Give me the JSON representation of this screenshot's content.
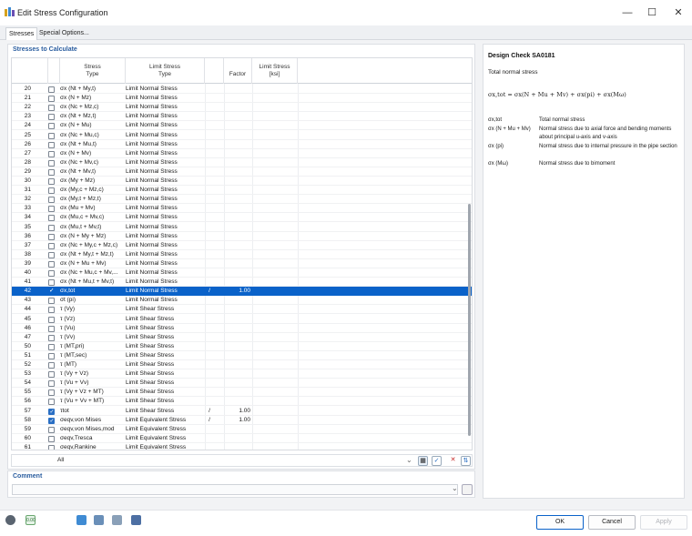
{
  "window": {
    "title": "Edit Stress Configuration",
    "min_glyph": "—",
    "max_glyph": "☐",
    "close_glyph": "✕"
  },
  "tabs": [
    {
      "label": "Stresses"
    },
    {
      "label": "Special Options..."
    }
  ],
  "stresses_panel": {
    "title": "Stresses to Calculate",
    "columns": {
      "stress_type": "Stress\nType",
      "limit_type": "Limit Stress\nType",
      "factor": "Factor",
      "limit_stress": "Limit Stress\n[ksi]"
    },
    "filter_value": "All",
    "rows": [
      {
        "num": "20",
        "checked": false,
        "type": "σx (Nt + My,t)",
        "limit": "Limit Normal Stress",
        "slash": "",
        "factor": ""
      },
      {
        "num": "21",
        "checked": false,
        "type": "σx (N + Mz)",
        "limit": "Limit Normal Stress",
        "slash": "",
        "factor": ""
      },
      {
        "num": "22",
        "checked": false,
        "type": "σx (Nc + Mz,c)",
        "limit": "Limit Normal Stress",
        "slash": "",
        "factor": ""
      },
      {
        "num": "23",
        "checked": false,
        "type": "σx (Nt + Mz,t)",
        "limit": "Limit Normal Stress",
        "slash": "",
        "factor": ""
      },
      {
        "num": "24",
        "checked": false,
        "type": "σx (N + Mu)",
        "limit": "Limit Normal Stress",
        "slash": "",
        "factor": ""
      },
      {
        "num": "25",
        "checked": false,
        "type": "σx (Nc + Mu,c)",
        "limit": "Limit Normal Stress",
        "slash": "",
        "factor": ""
      },
      {
        "num": "26",
        "checked": false,
        "type": "σx (Nt + Mu,t)",
        "limit": "Limit Normal Stress",
        "slash": "",
        "factor": ""
      },
      {
        "num": "27",
        "checked": false,
        "type": "σx (N + Mv)",
        "limit": "Limit Normal Stress",
        "slash": "",
        "factor": ""
      },
      {
        "num": "28",
        "checked": false,
        "type": "σx (Nc + Mv,c)",
        "limit": "Limit Normal Stress",
        "slash": "",
        "factor": ""
      },
      {
        "num": "29",
        "checked": false,
        "type": "σx (Nt + Mv,t)",
        "limit": "Limit Normal Stress",
        "slash": "",
        "factor": ""
      },
      {
        "num": "30",
        "checked": false,
        "type": "σx (My + Mz)",
        "limit": "Limit Normal Stress",
        "slash": "",
        "factor": ""
      },
      {
        "num": "31",
        "checked": false,
        "type": "σx (My,c + Mz,c)",
        "limit": "Limit Normal Stress",
        "slash": "",
        "factor": ""
      },
      {
        "num": "32",
        "checked": false,
        "type": "σx (My,t + Mz,t)",
        "limit": "Limit Normal Stress",
        "slash": "",
        "factor": ""
      },
      {
        "num": "33",
        "checked": false,
        "type": "σx (Mu + Mv)",
        "limit": "Limit Normal Stress",
        "slash": "",
        "factor": ""
      },
      {
        "num": "34",
        "checked": false,
        "type": "σx (Mu,c + Mv,c)",
        "limit": "Limit Normal Stress",
        "slash": "",
        "factor": ""
      },
      {
        "num": "35",
        "checked": false,
        "type": "σx (Mu,t + Mv,t)",
        "limit": "Limit Normal Stress",
        "slash": "",
        "factor": ""
      },
      {
        "num": "36",
        "checked": false,
        "type": "σx (N + My + Mz)",
        "limit": "Limit Normal Stress",
        "slash": "",
        "factor": ""
      },
      {
        "num": "37",
        "checked": false,
        "type": "σx (Nc + My,c + Mz,c)",
        "limit": "Limit Normal Stress",
        "slash": "",
        "factor": ""
      },
      {
        "num": "38",
        "checked": false,
        "type": "σx (Nt + My,t + Mz,t)",
        "limit": "Limit Normal Stress",
        "slash": "",
        "factor": ""
      },
      {
        "num": "39",
        "checked": false,
        "type": "σx (N + Mu + Mv)",
        "limit": "Limit Normal Stress",
        "slash": "",
        "factor": ""
      },
      {
        "num": "40",
        "checked": false,
        "type": "σx (Nc + Mu,c + Mv,...",
        "limit": "Limit Normal Stress",
        "slash": "",
        "factor": ""
      },
      {
        "num": "41",
        "checked": false,
        "type": "σx (Nt + Mu,t + Mv,t)",
        "limit": "Limit Normal Stress",
        "slash": "",
        "factor": ""
      },
      {
        "num": "42",
        "checked": true,
        "selected": true,
        "type": "σx,tot",
        "limit": "Limit Normal Stress",
        "slash": "/",
        "factor": "1.00"
      },
      {
        "num": "43",
        "checked": false,
        "type": "σt (pi)",
        "limit": "Limit Normal Stress",
        "slash": "",
        "factor": ""
      },
      {
        "num": "44",
        "checked": false,
        "type": "τ (Vy)",
        "limit": "Limit Shear Stress",
        "slash": "",
        "factor": ""
      },
      {
        "num": "45",
        "checked": false,
        "type": "τ (Vz)",
        "limit": "Limit Shear Stress",
        "slash": "",
        "factor": ""
      },
      {
        "num": "46",
        "checked": false,
        "type": "τ (Vu)",
        "limit": "Limit Shear Stress",
        "slash": "",
        "factor": ""
      },
      {
        "num": "47",
        "checked": false,
        "type": "τ (Vv)",
        "limit": "Limit Shear Stress",
        "slash": "",
        "factor": ""
      },
      {
        "num": "50",
        "checked": false,
        "type": "τ (MT,pri)",
        "limit": "Limit Shear Stress",
        "slash": "",
        "factor": ""
      },
      {
        "num": "51",
        "checked": false,
        "type": "τ (MT,sec)",
        "limit": "Limit Shear Stress",
        "slash": "",
        "factor": ""
      },
      {
        "num": "52",
        "checked": false,
        "type": "τ (MT)",
        "limit": "Limit Shear Stress",
        "slash": "",
        "factor": ""
      },
      {
        "num": "53",
        "checked": false,
        "type": "τ (Vy + Vz)",
        "limit": "Limit Shear Stress",
        "slash": "",
        "factor": ""
      },
      {
        "num": "54",
        "checked": false,
        "type": "τ (Vu + Vv)",
        "limit": "Limit Shear Stress",
        "slash": "",
        "factor": ""
      },
      {
        "num": "55",
        "checked": false,
        "type": "τ (Vy + Vz + MT)",
        "limit": "Limit Shear Stress",
        "slash": "",
        "factor": ""
      },
      {
        "num": "56",
        "checked": false,
        "type": "τ (Vu + Vv + MT)",
        "limit": "Limit Shear Stress",
        "slash": "",
        "factor": ""
      },
      {
        "num": "57",
        "checked": true,
        "type": "τtot",
        "limit": "Limit Shear Stress",
        "slash": "/",
        "factor": "1.00"
      },
      {
        "num": "58",
        "checked": true,
        "type": "σeqv,von Mises",
        "limit": "Limit Equivalent Stress",
        "slash": "/",
        "factor": "1.00"
      },
      {
        "num": "59",
        "checked": false,
        "type": "σeqv,von Mises,mod",
        "limit": "Limit Equivalent Stress",
        "slash": "",
        "factor": ""
      },
      {
        "num": "60",
        "checked": false,
        "type": "σeqv,Tresca",
        "limit": "Limit Equivalent Stress",
        "slash": "",
        "factor": ""
      },
      {
        "num": "61",
        "checked": false,
        "type": "σeqv,Rankine",
        "limit": "Limit Equivalent Stress",
        "slash": "",
        "factor": ""
      }
    ]
  },
  "comment": {
    "title": "Comment",
    "value": ""
  },
  "design_check": {
    "title": "Design Check SA0181",
    "subtitle": "Total normal stress",
    "formula": "σx,tot = σx(N + Mu + Mv) + σx(pi) + σx(Mω)",
    "legend": [
      {
        "symbol": "σx,tot",
        "desc": "Total normal stress"
      },
      {
        "symbol": "σx (N + Mu + Mv)",
        "desc": "Normal stress due to axial force and bending moments about principal u-axis and v-axis"
      },
      {
        "symbol": "σx (pi)",
        "desc": "Normal stress due to internal pressure in the pipe section"
      },
      {
        "symbol": "σx (Mω)",
        "desc": "Normal stress due to bimoment"
      }
    ]
  },
  "footer": {
    "ok": "OK",
    "cancel": "Cancel",
    "apply": "Apply",
    "zoom_icon_text": "0.00"
  },
  "colors": {
    "selection": "#0a62c9",
    "accent_title": "#2a5d9f"
  }
}
